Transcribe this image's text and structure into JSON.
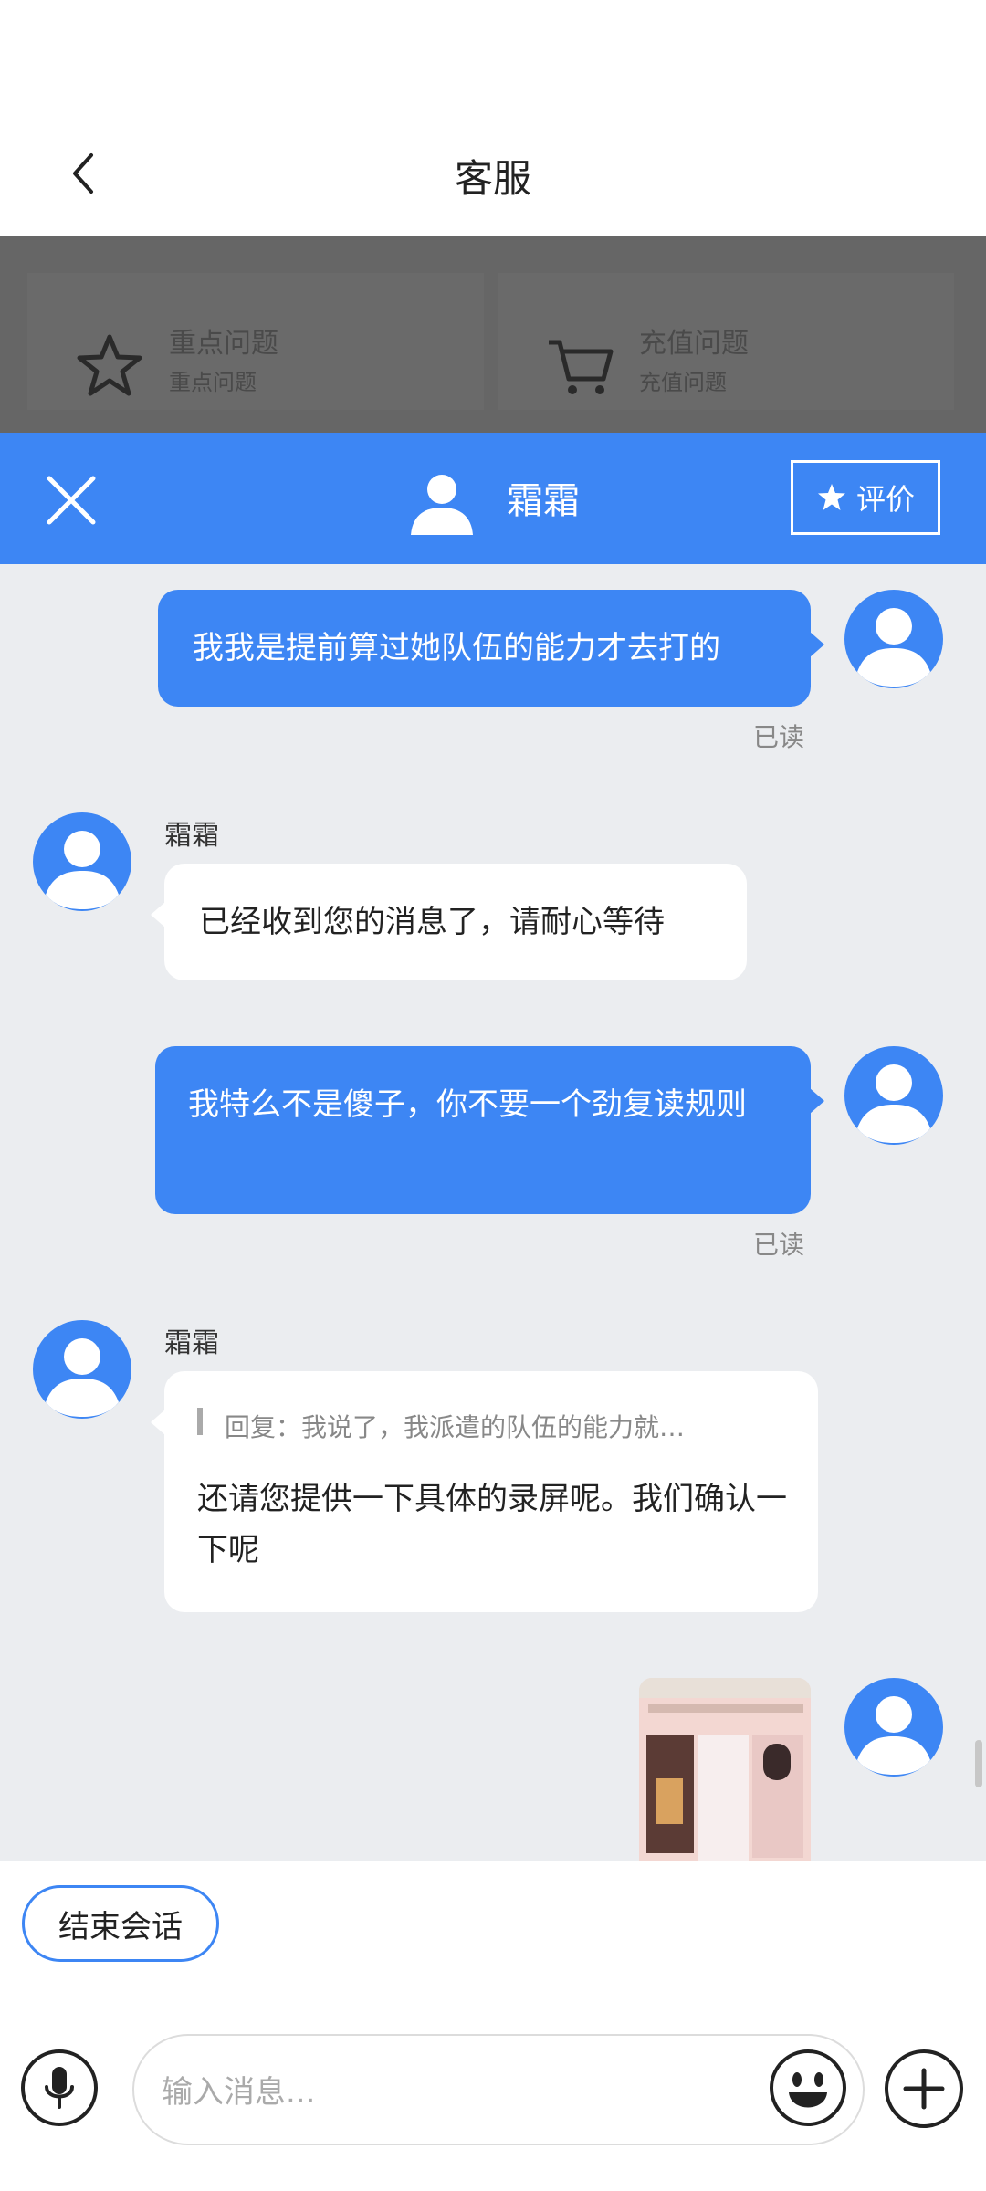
{
  "nav": {
    "title": "客服"
  },
  "faq": [
    {
      "title": "重点问题",
      "subtitle": "重点问题",
      "icon": "star-outline-icon"
    },
    {
      "title": "充值问题",
      "subtitle": "充值问题",
      "icon": "cart-icon"
    }
  ],
  "chat_header": {
    "agent_name": "霜霜",
    "rate_label": "评价"
  },
  "messages": [
    {
      "from": "me",
      "text": "我我是提前算过她队伍的能力才去打的",
      "status": "已读"
    },
    {
      "from": "agent",
      "sender": "霜霜",
      "text": "已经收到您的消息了，请耐心等待"
    },
    {
      "from": "me",
      "text": "我特么不是傻子，你不要一个劲复读规则",
      "status": "已读"
    },
    {
      "from": "agent",
      "sender": "霜霜",
      "quote": "回复：我说了，我派遣的队伍的能力就…",
      "text": "还请您提供一下具体的录屏呢。我们确认一下呢"
    },
    {
      "from": "me",
      "type": "image"
    }
  ],
  "footer": {
    "end_label": "结束会话",
    "input_placeholder": "输入消息..."
  },
  "colors": {
    "accent": "#3d86f4",
    "chat_bg": "#ebedf0"
  }
}
